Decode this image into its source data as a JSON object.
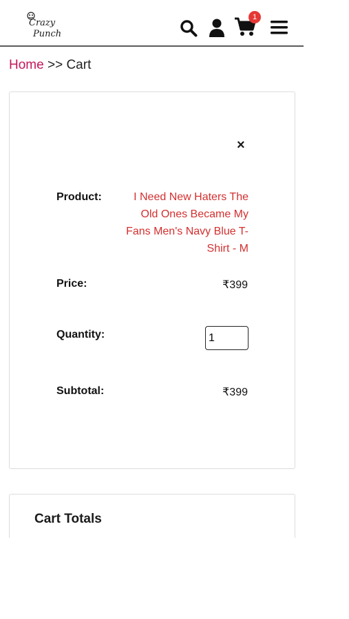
{
  "header": {
    "logo_line1": "Crazy",
    "logo_line2": "Punch",
    "cart_count": "1",
    "icons": [
      "search-icon",
      "user-icon",
      "cart-icon",
      "menu-icon"
    ]
  },
  "breadcrumb": {
    "home": "Home",
    "separator": ">>",
    "current": "Cart"
  },
  "cart": {
    "remove_label": "×",
    "product_label": "Product:",
    "product_name": "I Need New Haters The Old Ones Became My Fans Men's Navy Blue T-Shirt - M",
    "price_label": "Price:",
    "price_value": "₹399",
    "quantity_label": "Quantity:",
    "quantity_value": "1",
    "subtotal_label": "Subtotal:",
    "subtotal_value": "₹399"
  },
  "totals": {
    "title": "Cart Totals"
  },
  "colors": {
    "link": "#c2185b",
    "product": "#d32f2f",
    "badge": "#e53935"
  }
}
